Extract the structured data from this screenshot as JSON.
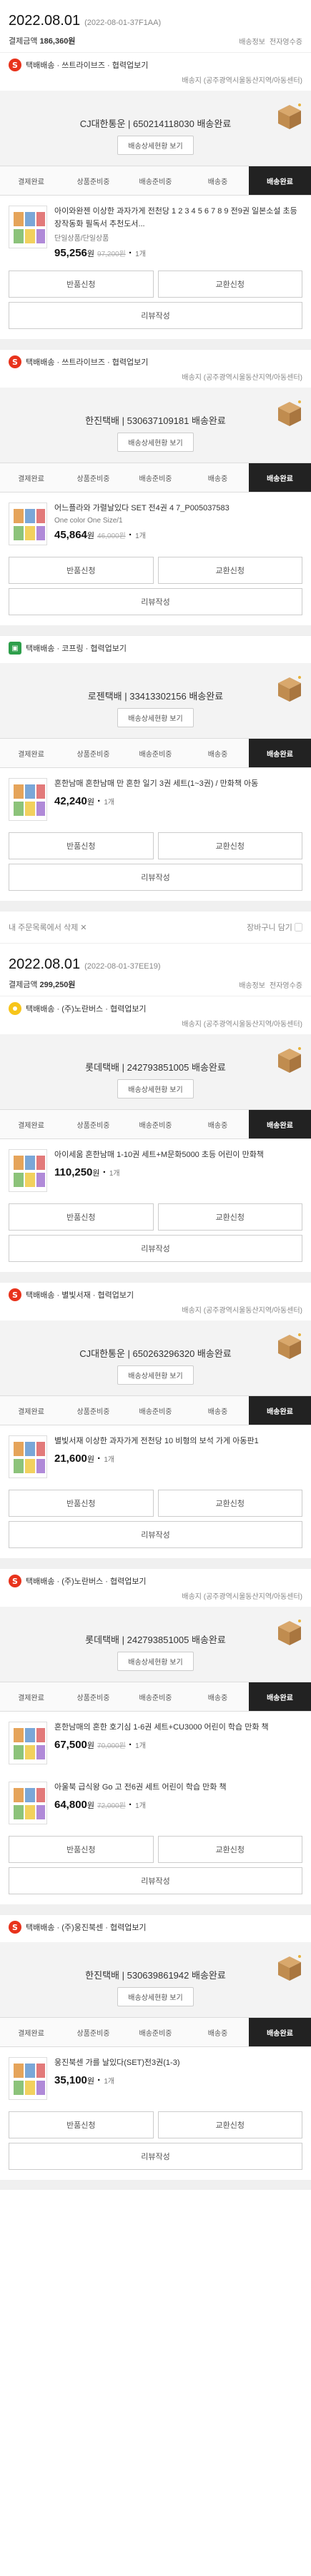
{
  "orders": [
    {
      "date": "2022.08.01",
      "order_no": "(2022-08-01-37F1AA)",
      "payment_label": "결제금액",
      "payment_amount": "186,360원",
      "links": [
        "배송정보",
        "전자영수증"
      ],
      "shipments": [
        {
          "badge": "S",
          "head": "택배배송 · 쓰트라이브즈 · 협력업보기",
          "sub": "배송지 (공주광역시울동산지역/아동센터)",
          "carrier": "CJ대한통운 | 650214118030 배송완료",
          "detail_btn": "배송상세현황 보기",
          "items": [
            {
              "title": "아이와완젠 이상한 과자가게 전천당 1 2 3 4 5 6 7 8 9 전9권 일본소설 초등 장작동화 필독서 추천도서...",
              "opt": "단일상품/단일상품",
              "price": "95,256",
              "won": "원",
              "orig": "97,200원",
              "qty": "1개"
            }
          ]
        },
        {
          "badge": "S",
          "head": "택배배송 · 쓰트라이브즈 · 협력업보기",
          "sub": "배송지 (공주광역시울동산지역/아동센터)",
          "carrier": "한진택배 | 530637109181 배송완료",
          "detail_btn": "배송상세현황 보기",
          "items": [
            {
              "title": "어느플라와 가렬날있다 SET 전4권 4 7_P005037583",
              "opt": "One color One Size/1",
              "price": "45,864",
              "won": "원",
              "orig": "46,000원",
              "qty": "1개"
            }
          ]
        },
        {
          "badge": "G",
          "head": "택배배송 · 코프링 · 협력업보기",
          "sub": "",
          "carrier": "로젠택배 | 33413302156 배송완료",
          "detail_btn": "배송상세현황 보기",
          "items": [
            {
              "title": "혼한남매 혼한남매 만 혼한 일기 3권 세트(1~3권) / 만화책 아동",
              "opt": "",
              "price": "42,240",
              "won": "원",
              "orig": "",
              "qty": "1개"
            }
          ]
        }
      ]
    },
    {
      "date": "2022.08.01",
      "order_no": "(2022-08-01-37EE19)",
      "payment_label": "결제금액",
      "payment_amount": "299,250원",
      "links": [
        "배송정보",
        "전자영수증"
      ],
      "shipments": [
        {
          "badge": "Y",
          "head": "택배배송 · (주)노란버스 · 협력업보기",
          "sub": "배송지 (공주광역시울동산지역/아동센터)",
          "carrier": "롯데택배 | 242793851005 배송완료",
          "detail_btn": "배송상세현황 보기",
          "items": [
            {
              "title": "아이세움 혼한남매 1-10권 세트+M문화5000 초등 어린이 만화책",
              "opt": "",
              "price": "110,250",
              "won": "원",
              "orig": "",
              "qty": "1개"
            }
          ]
        },
        {
          "badge": "S",
          "head": "택배배송 · 별빛서재 · 협력업보기",
          "sub": "배송지 (공주광역시울동산지역/아동센터)",
          "carrier": "CJ대한통운 | 650263296320 배송완료",
          "detail_btn": "배송상세현황 보기",
          "items": [
            {
              "title": "별빛서재 이상한 과자가게 전천당 10 비형의 보석 가게 아동판1",
              "opt": "",
              "price": "21,600",
              "won": "원",
              "orig": "",
              "qty": "1개"
            }
          ]
        },
        {
          "badge": "S",
          "head": "택배배송 · (주)노란버스 · 협력업보기",
          "sub": "배송지 (공주광역시울동산지역/아동센터)",
          "carrier": "롯데택배 | 242793851005 배송완료",
          "detail_btn": "배송상세현황 보기",
          "items": [
            {
              "title": "혼한남매의 혼한 호기심 1-6권 세트+CU3000 어린이 학습 만화 책",
              "opt": "",
              "price": "67,500",
              "won": "원",
              "orig": "70,000원",
              "qty": "1개"
            },
            {
              "title": "아울북 급식왕 Go 고 전6권 세트 어린이 학습 만화 책",
              "opt": "",
              "price": "64,800",
              "won": "원",
              "orig": "72,000원",
              "qty": "1개"
            }
          ]
        },
        {
          "badge": "S",
          "head": "택배배송 · (주)웅진북센 · 협력업보기",
          "sub": "",
          "carrier": "한진택배 | 530639861942 배송완료",
          "detail_btn": "배송상세현황 보기",
          "items": [
            {
              "title": "웅진북센 가를 날있다(SET)전3권(1-3)",
              "opt": "",
              "price": "35,100",
              "won": "원",
              "orig": "",
              "qty": "1개"
            }
          ]
        }
      ]
    }
  ],
  "steps": [
    "결제완료",
    "상품준비중",
    "배송준비중",
    "배송중",
    "배송완료"
  ],
  "buttons": {
    "return": "반품신청",
    "exchange": "교환신청",
    "review": "리뷰작성"
  },
  "bottom_bar": {
    "left": "내 주문목록에서 삭제 ✕",
    "right": "장바구니 담기 ▢"
  },
  "colors": {
    "accent": "#e8331c",
    "active_step": "#222222"
  }
}
